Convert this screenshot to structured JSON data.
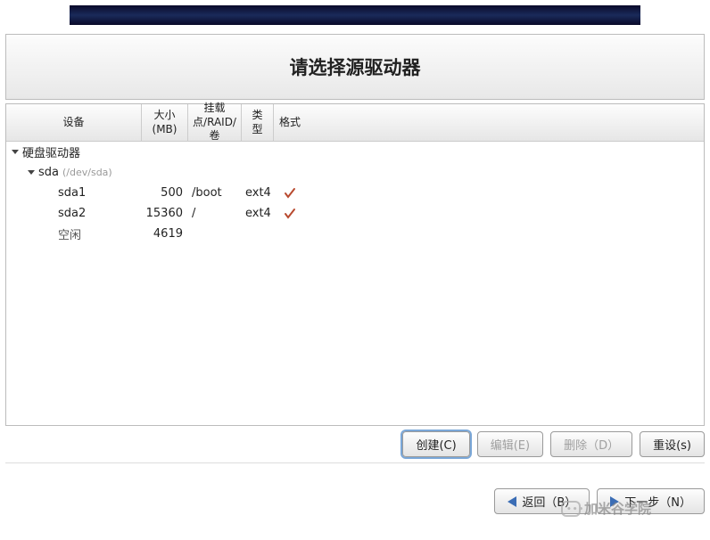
{
  "title": "请选择源驱动器",
  "columns": {
    "device": "设备",
    "size": "大小(MB)",
    "mount": "挂载点/RAID/卷",
    "type": "类型",
    "format": "格式"
  },
  "tree": {
    "root_label": "硬盘驱动器",
    "disk": {
      "name": "sda",
      "path": "(/dev/sda)"
    },
    "partitions": [
      {
        "name": "sda1",
        "size": "500",
        "mount": "/boot",
        "type": "ext4",
        "format": true
      },
      {
        "name": "sda2",
        "size": "15360",
        "mount": "/",
        "type": "ext4",
        "format": true
      },
      {
        "name": "空闲",
        "size": "4619",
        "mount": "",
        "type": "",
        "format": false,
        "free": true
      }
    ]
  },
  "buttons": {
    "create": "创建(C)",
    "edit": "编辑(E)",
    "delete": "删除（D）",
    "reset": "重设(s)",
    "back": "返回（B）",
    "next": "下一步（N）"
  },
  "watermark": "加米谷学院"
}
